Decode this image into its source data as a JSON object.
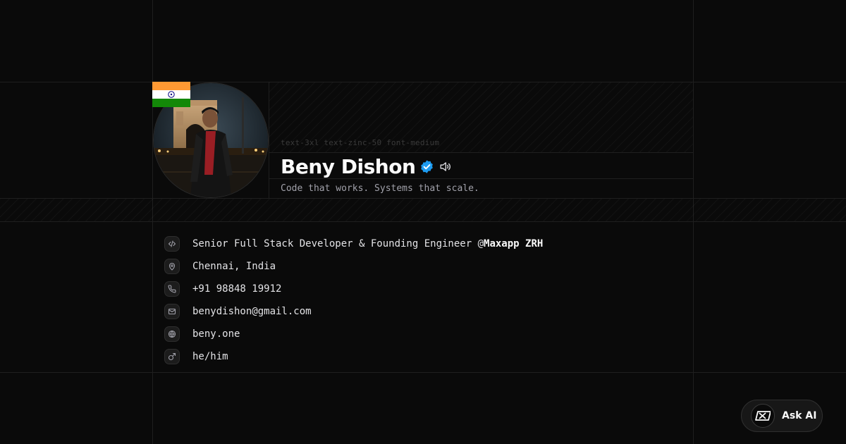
{
  "profile": {
    "class_hint": "text-3xl text-zinc-50 font-medium",
    "name": "Beny Dishon",
    "tagline": "Code that works. Systems that scale.",
    "avatar_alt": "Beny Dishon",
    "flag_country": "India"
  },
  "info": {
    "role_prefix": "Senior Full Stack Developer & Founding Engineer @",
    "company": "Maxapp ZRH",
    "location": "Chennai, India",
    "phone": "+91 98848 19912",
    "email": "benydishon@gmail.com",
    "website": "beny.one",
    "pronouns": "he/him"
  },
  "icons": {
    "role": "code-icon",
    "location": "map-pin-icon",
    "phone": "phone-icon",
    "email": "mail-icon",
    "website": "globe-icon",
    "pronouns": "male-symbol-icon"
  },
  "ask_ai": {
    "label": "Ask AI"
  },
  "colors": {
    "background": "#0a0a0a",
    "verified": "#1d9bf0",
    "muted_text": "#a1a1aa"
  }
}
